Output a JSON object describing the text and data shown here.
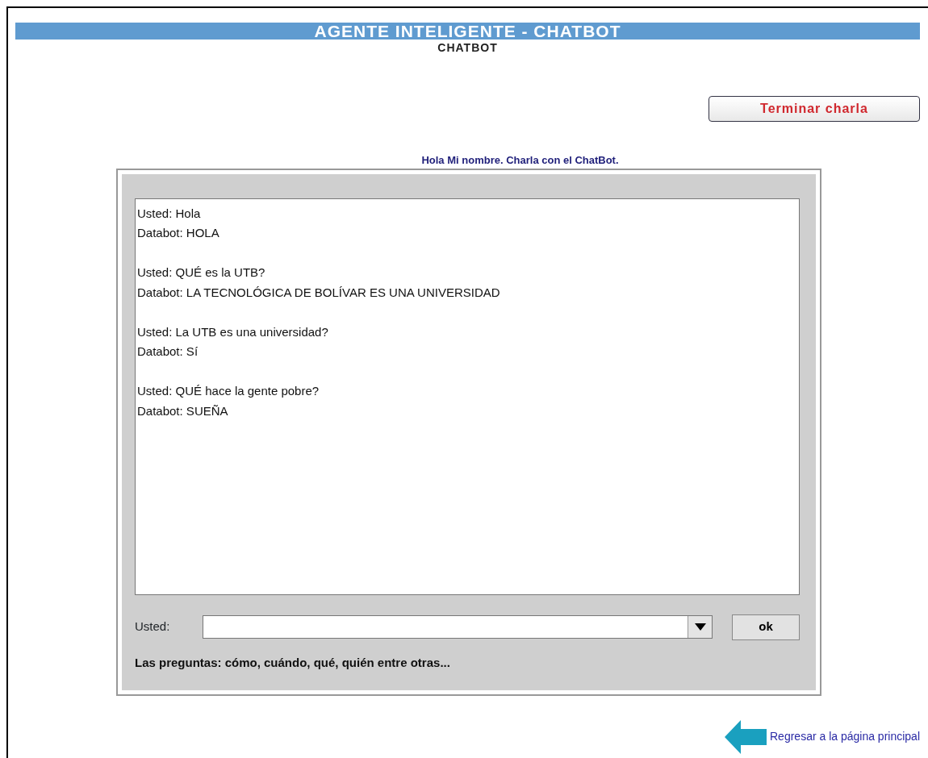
{
  "header": {
    "title": "AGENTE INTELIGENTE - CHATBOT",
    "subtitle": "CHATBOT"
  },
  "end_button": "Terminar charla",
  "greeting": "Hola Mi nombre. Charla con el ChatBot.",
  "conversation": [
    {
      "user": "Usted: Hola",
      "bot": "Databot: HOLA"
    },
    {
      "user": "Usted: QUÉ es la UTB?",
      "bot": "Databot: LA TECNOLÓGICA DE BOLÍVAR ES UNA UNIVERSIDAD"
    },
    {
      "user": "Usted: La UTB es una universidad?",
      "bot": "Databot: Sí"
    },
    {
      "user": "Usted: QUÉ hace la gente pobre?",
      "bot": "Databot: SUEÑA"
    }
  ],
  "input": {
    "label": "Usted:",
    "send_button": "ok"
  },
  "hint": "Las preguntas: cómo, cuándo, qué, quién entre otras...",
  "back_link": "Regresar a la página principal"
}
